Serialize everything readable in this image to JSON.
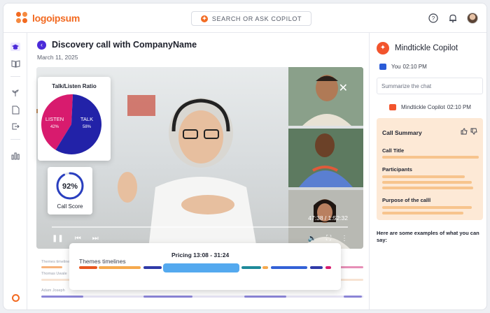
{
  "app": {
    "logo_text": "logoipsum"
  },
  "search": {
    "label": "SEARCH OR ASK COPILOT"
  },
  "call": {
    "title": "Discovery call with CompanyName",
    "date": "March 11, 2025",
    "timecode": "47:38 / 1:52:32"
  },
  "talk_listen": {
    "title": "Talk/Listen Ratio",
    "listen_label": "LISTEN",
    "listen_pct": "42%",
    "talk_label": "TALK",
    "talk_pct": "58%",
    "listen_value": 42,
    "talk_value": 58,
    "colors": {
      "listen": "#d81b6e",
      "talk": "#2222a8"
    }
  },
  "call_score": {
    "value": "92%",
    "label": "Call Score",
    "fraction": 0.92
  },
  "timeline": {
    "rows": [
      "Themes timelines",
      "Thomas Uwale",
      "Adam Joseph"
    ],
    "themes_label": "Themes timelines",
    "pricing_label": "Pricing 13:08 - 31:24"
  },
  "copilot": {
    "title": "Mindtickle Copilot",
    "you_label": "You",
    "you_time": "02:10 PM",
    "prompt": "Summarize the chat",
    "bot_label": "Mindtickle Copilot",
    "bot_time": "02:10 PM"
  },
  "summary": {
    "title": "Call Summary",
    "sections": [
      "Call Title",
      "Participants",
      "Purpose of the calll"
    ]
  },
  "examples_text": "Here are some examples of what you can say:"
}
